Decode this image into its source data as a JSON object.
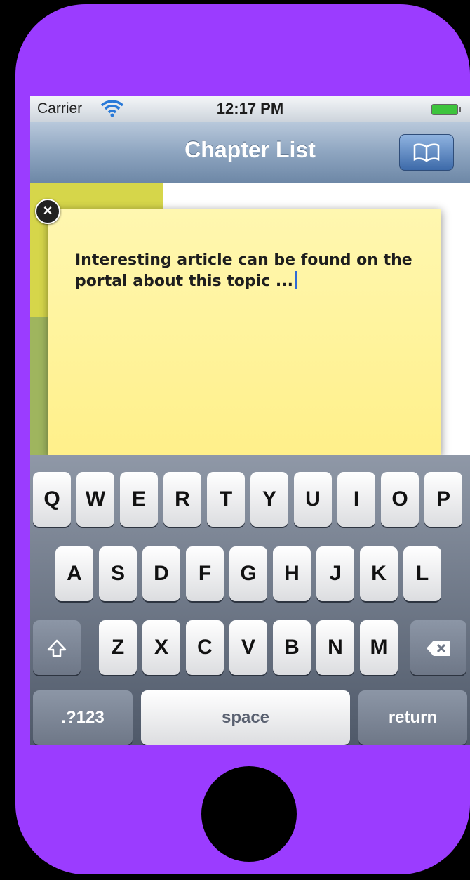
{
  "status": {
    "carrier": "Carrier",
    "time": "12:17 PM"
  },
  "nav": {
    "title": "Chapter List"
  },
  "note": {
    "text": "Interesting article can be found on the portal about this topic ..."
  },
  "keyboard": {
    "row1": [
      "Q",
      "W",
      "E",
      "R",
      "T",
      "Y",
      "U",
      "I",
      "O",
      "P"
    ],
    "row2": [
      "A",
      "S",
      "D",
      "F",
      "G",
      "H",
      "J",
      "K",
      "L"
    ],
    "row3": [
      "Z",
      "X",
      "C",
      "V",
      "B",
      "N",
      "M"
    ],
    "numbers_label": ".?123",
    "space_label": "space",
    "return_label": "return"
  },
  "icons": {
    "shift": "shift-icon",
    "delete": "delete-icon",
    "book": "book-icon",
    "wifi": "wifi-icon",
    "battery": "battery-icon",
    "close": "close-icon"
  },
  "colors": {
    "phone_frame": "#9b3cff",
    "note": "#fff08a",
    "nav": "#8ea5c0",
    "cursor": "#2f6bd5"
  }
}
